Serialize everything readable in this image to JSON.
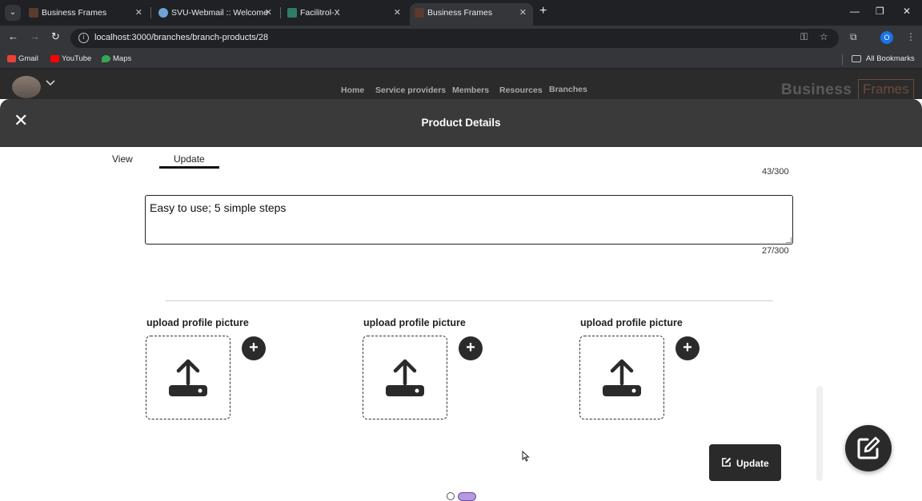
{
  "browser": {
    "tabs": [
      {
        "title": "Business Frames",
        "active": false
      },
      {
        "title": "SVU-Webmail :: Welcome",
        "active": false
      },
      {
        "title": "Facilitrol-X",
        "active": false
      },
      {
        "title": "Business Frames",
        "active": true
      }
    ],
    "url": "localhost:3000/branches/branch-products/28",
    "profile_initial": "O",
    "bookmarks": [
      {
        "label": "Gmail",
        "color": "#ea4335"
      },
      {
        "label": "YouTube",
        "color": "#ff0000"
      },
      {
        "label": "Maps",
        "color": "#34a853"
      }
    ],
    "all_bookmarks": "All Bookmarks"
  },
  "app_nav": {
    "links": [
      "Home",
      "Service providers",
      "Members",
      "Resources",
      "Branches"
    ],
    "logo_primary": "Business",
    "logo_secondary": "Frames"
  },
  "modal": {
    "title": "Product Details",
    "tabs": [
      {
        "label": "View",
        "active": false
      },
      {
        "label": "Update",
        "active": true
      }
    ],
    "counter_top": "43/300",
    "description_value": "Easy to use; 5 simple steps",
    "counter_bottom": "27/300",
    "uploads": [
      {
        "label": "upload profile picture"
      },
      {
        "label": "upload profile picture"
      },
      {
        "label": "upload profile picture"
      }
    ],
    "update_button": "Update",
    "pagination": {
      "total": 2,
      "active_index": 1
    }
  },
  "colors": {
    "chrome_dark": "#202124",
    "nav_bg": "#2b2b2b",
    "modal_header": "#3a3a3a",
    "logo_accent": "#6b4b3a",
    "pagination_active": "#b59ae0"
  }
}
